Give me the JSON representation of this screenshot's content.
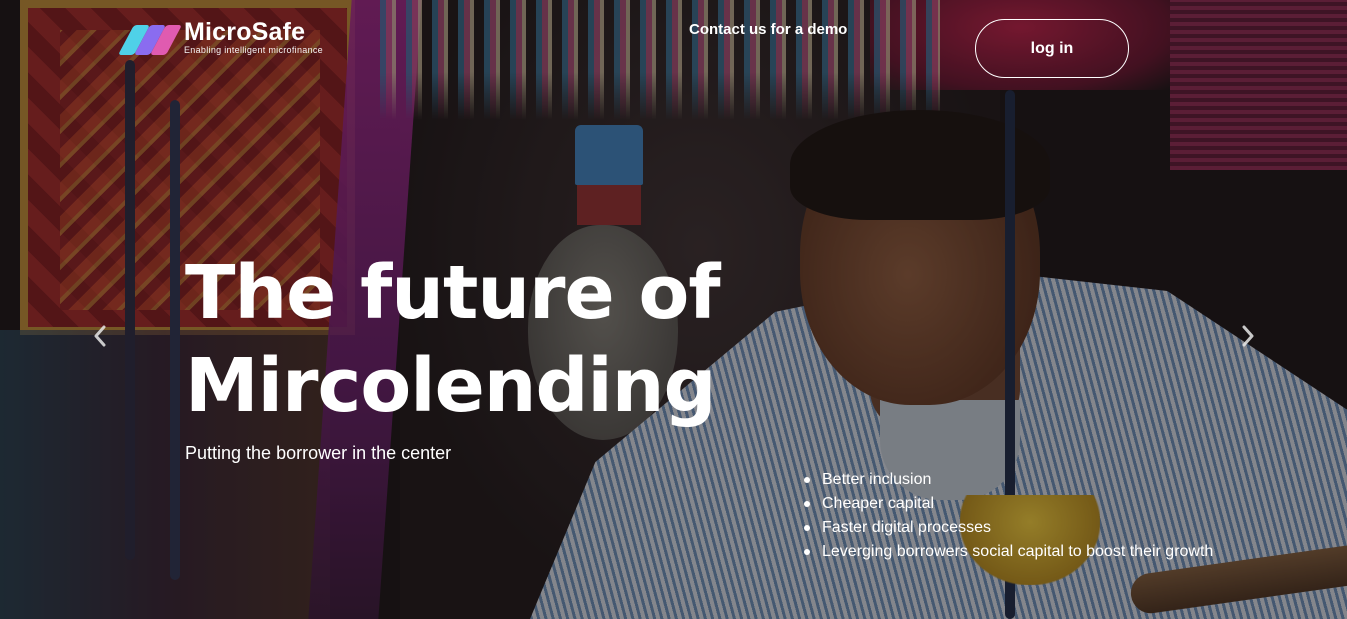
{
  "header": {
    "logo_name": "MicroSafe",
    "logo_tagline": "Enabling intelligent microfinance",
    "contact_link": "Contact us for a demo",
    "login_label": "log in"
  },
  "hero": {
    "headline_line1": "The future of",
    "headline_line2": "Mircolending",
    "subtitle": "Putting the borrower in the center",
    "bullets": [
      "Better inclusion",
      "Cheaper capital",
      "Faster digital processes",
      "Leverging borrowers social capital to boost their growth"
    ]
  },
  "carousel": {
    "prev_icon": "chevron-left-icon",
    "next_icon": "chevron-right-icon"
  },
  "colors": {
    "logo_gradient_1": "#4fd1e8",
    "logo_gradient_2": "#8a6cf0",
    "logo_gradient_3": "#e05bb0",
    "text": "#ffffff"
  }
}
